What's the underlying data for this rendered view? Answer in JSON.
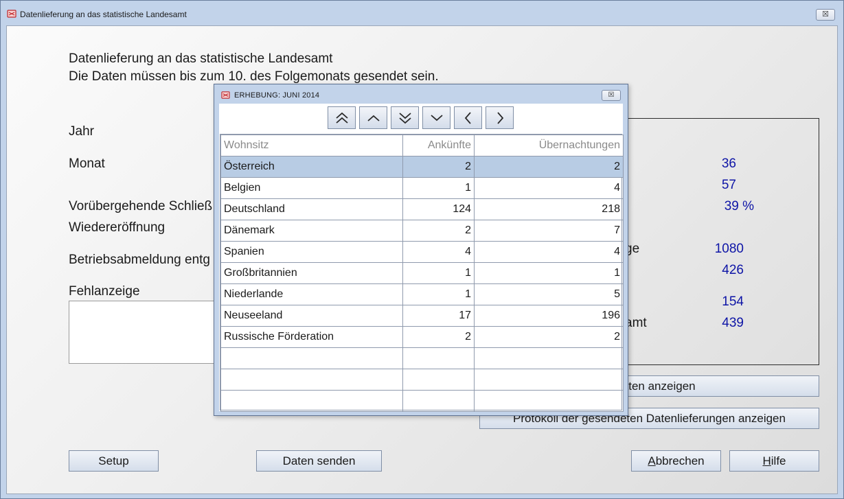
{
  "window": {
    "title": "Datenlieferung an das statistische Landesamt",
    "close_label": "☒"
  },
  "header": {
    "line1": "Datenlieferung an das statistische Landesamt",
    "line2": "Die Daten müssen bis zum 10. des Folgemonats gesendet sein."
  },
  "form": {
    "jahr_label": "Jahr",
    "monat_label": "Monat",
    "schliessung_label": "Vorübergehende Schließ",
    "wiedereroeffnung_label": "Wiedereröffnung",
    "betriebsabmeldung_label": "Betriebsabmeldung entg",
    "fehlanzeige_label": "Fehlanzeige"
  },
  "stats": {
    "values": [
      "36",
      "57",
      "39 %",
      "1080",
      "426",
      "154",
      "439"
    ],
    "partial_label_1": "ge",
    "partial_label_2": "amt"
  },
  "buttons": {
    "erhebungsdaten": "gsdaten anzeigen",
    "protokoll": "Protokoll der gesendeten Datenlieferungen anzeigen",
    "setup": "Setup",
    "daten_senden": "Daten senden",
    "abbrechen_first": "A",
    "abbrechen_rest": "bbrechen",
    "hilfe_first": "H",
    "hilfe_rest": "ilfe"
  },
  "dialog": {
    "title": "ERHEBUNG:   JUNI 2014",
    "close_label": "☒",
    "nav_icons": [
      "double-chevron-up-icon",
      "chevron-up-icon",
      "double-chevron-down-icon",
      "chevron-down-icon",
      "chevron-left-icon",
      "chevron-right-icon"
    ],
    "columns": [
      "Wohnsitz",
      "Ankünfte",
      "Übernachtungen"
    ],
    "rows": [
      [
        "Österreich",
        "2",
        "2"
      ],
      [
        "Belgien",
        "1",
        "4"
      ],
      [
        "Deutschland",
        "124",
        "218"
      ],
      [
        "Dänemark",
        "2",
        "7"
      ],
      [
        "Spanien",
        "4",
        "4"
      ],
      [
        "Großbritannien",
        "1",
        "1"
      ],
      [
        "Niederlande",
        "1",
        "5"
      ],
      [
        "Neuseeland",
        "17",
        "196"
      ],
      [
        "Russische Förderation",
        "2",
        "2"
      ]
    ],
    "selected_row": 0
  },
  "colors": {
    "accent_value": "#0d14a6",
    "selection": "#b8cce4",
    "frame": "#c2d3ea"
  }
}
